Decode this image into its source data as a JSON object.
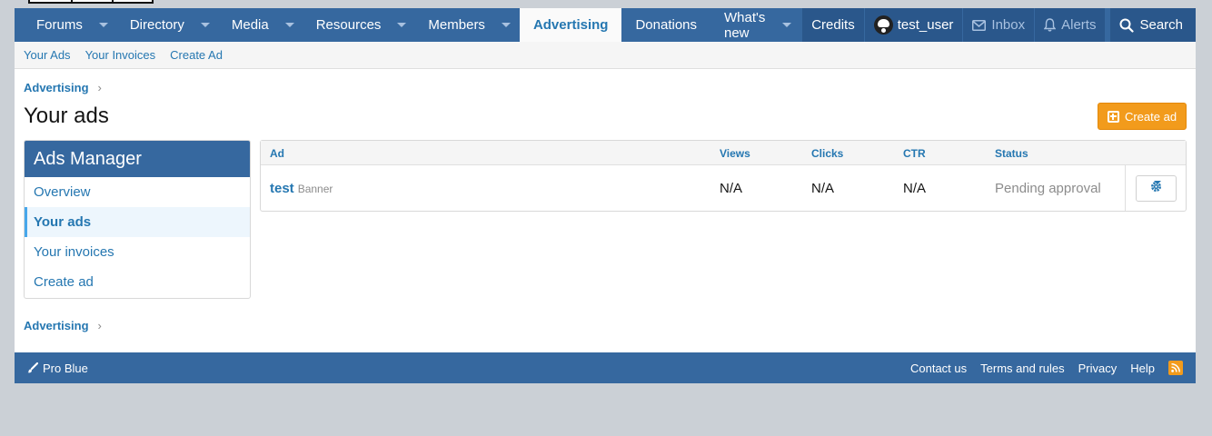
{
  "nav": {
    "tabs": [
      {
        "label": "Forums",
        "has_menu": true
      },
      {
        "label": "Directory",
        "has_menu": true
      },
      {
        "label": "Media",
        "has_menu": true
      },
      {
        "label": "Resources",
        "has_menu": true
      },
      {
        "label": "Members",
        "has_menu": true
      },
      {
        "label": "Advertising",
        "active": true
      },
      {
        "label": "Donations"
      },
      {
        "label": "What's new",
        "has_menu": true
      }
    ],
    "account": {
      "credits": "Credits",
      "username": "test_user",
      "inbox": "Inbox",
      "alerts": "Alerts",
      "search": "Search"
    }
  },
  "subnav": {
    "items": [
      "Your Ads",
      "Your Invoices",
      "Create Ad"
    ]
  },
  "breadcrumb": {
    "label": "Advertising"
  },
  "page": {
    "title": "Your ads",
    "create_button": "Create ad"
  },
  "sidebar": {
    "title": "Ads Manager",
    "items": [
      {
        "label": "Overview"
      },
      {
        "label": "Your ads",
        "selected": true
      },
      {
        "label": "Your invoices"
      },
      {
        "label": "Create ad"
      }
    ]
  },
  "table": {
    "columns": [
      "Ad",
      "Views",
      "Clicks",
      "CTR",
      "Status"
    ],
    "rows": [
      {
        "name": "test",
        "type": "Banner",
        "views": "N/A",
        "clicks": "N/A",
        "ctr": "N/A",
        "status": "Pending approval"
      }
    ]
  },
  "footer": {
    "style": "Pro Blue",
    "links": [
      "Contact us",
      "Terms and rules",
      "Privacy",
      "Help"
    ]
  },
  "colors": {
    "header": "#36689f",
    "accent_button": "#f29b1c",
    "link": "#2577b1"
  }
}
